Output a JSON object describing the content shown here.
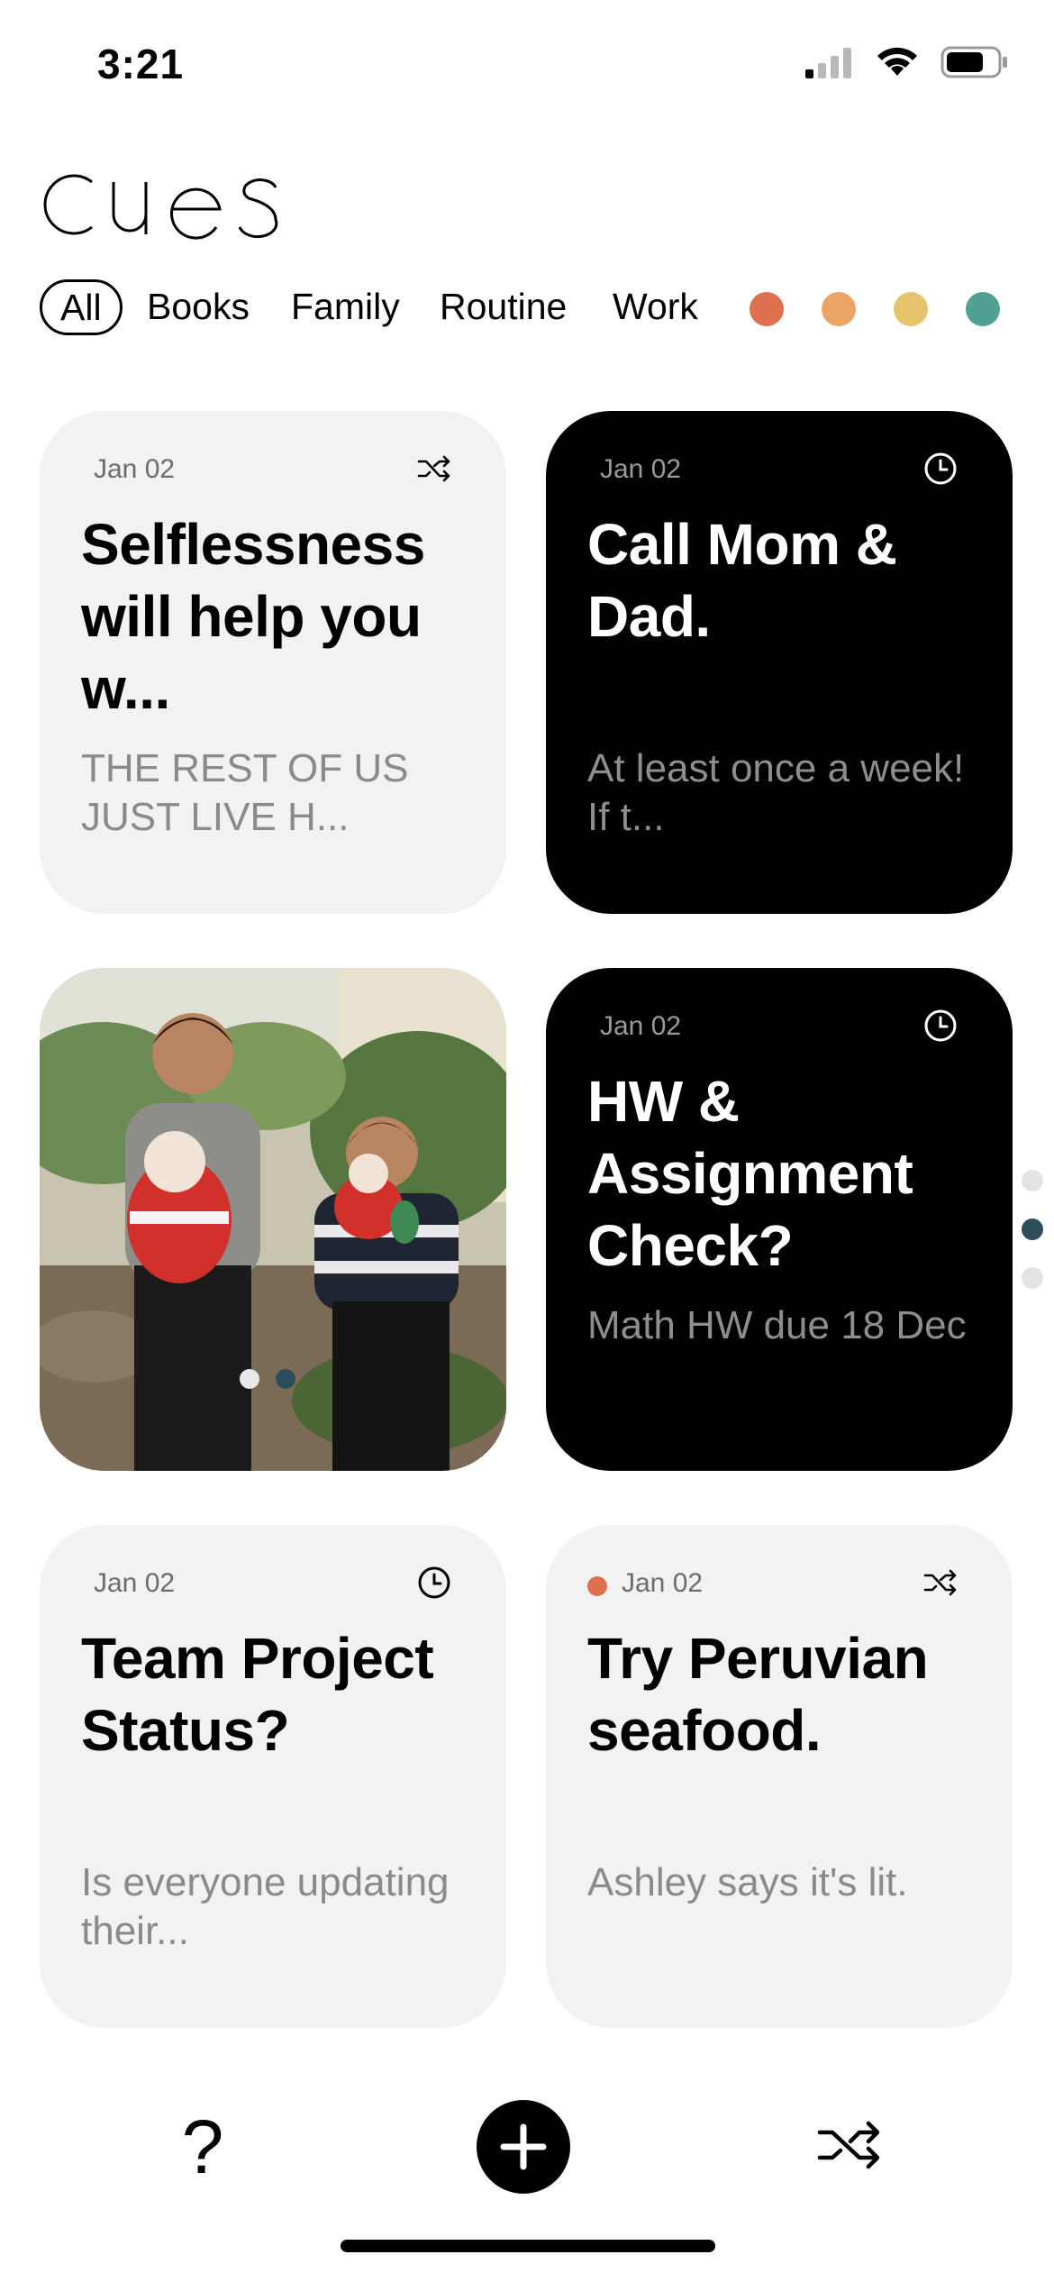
{
  "status_bar": {
    "time": "3:21"
  },
  "app": {
    "logo_text": "cues"
  },
  "filters": {
    "tabs": [
      {
        "label": "All",
        "active": true
      },
      {
        "label": "Books",
        "active": false
      },
      {
        "label": "Family",
        "active": false
      },
      {
        "label": "Routine",
        "active": false
      },
      {
        "label": "Work",
        "active": false
      }
    ],
    "color_tags": [
      "#de6f4f",
      "#eca366",
      "#e6c46d",
      "#529f93"
    ]
  },
  "cards": [
    {
      "date": "Jan 02",
      "icon": "shuffle-icon",
      "theme": "light",
      "title": "Selflessness will help you w...",
      "body": "THE REST OF US JUST LIVE H..."
    },
    {
      "date": "Jan 02",
      "icon": "clock-icon",
      "theme": "dark",
      "title": "Call Mom & Dad.",
      "body": "At least once a week! If t..."
    },
    {
      "type": "photo",
      "description_icon": "photo-card",
      "dots_total": 2,
      "dots_active": 2
    },
    {
      "date": "Jan 02",
      "icon": "clock-icon",
      "theme": "dark",
      "title": "HW & Assignment Check?",
      "body": "Math HW due 18 Dec"
    },
    {
      "date": "Jan 02",
      "icon": "clock-icon",
      "theme": "light",
      "title": "Team Project Status?",
      "body": "Is everyone updating their..."
    },
    {
      "date": "Jan 02",
      "icon": "shuffle-icon",
      "theme": "light",
      "tag_color": "#de6f4f",
      "title": "Try Peruvian seafood.",
      "body": "Ashley says it's lit."
    }
  ],
  "page_indicator": {
    "total": 3,
    "active": 2
  },
  "bottom_bar": {
    "help_label": "?",
    "add_icon": "plus-icon",
    "shuffle_icon": "shuffle-icon"
  }
}
